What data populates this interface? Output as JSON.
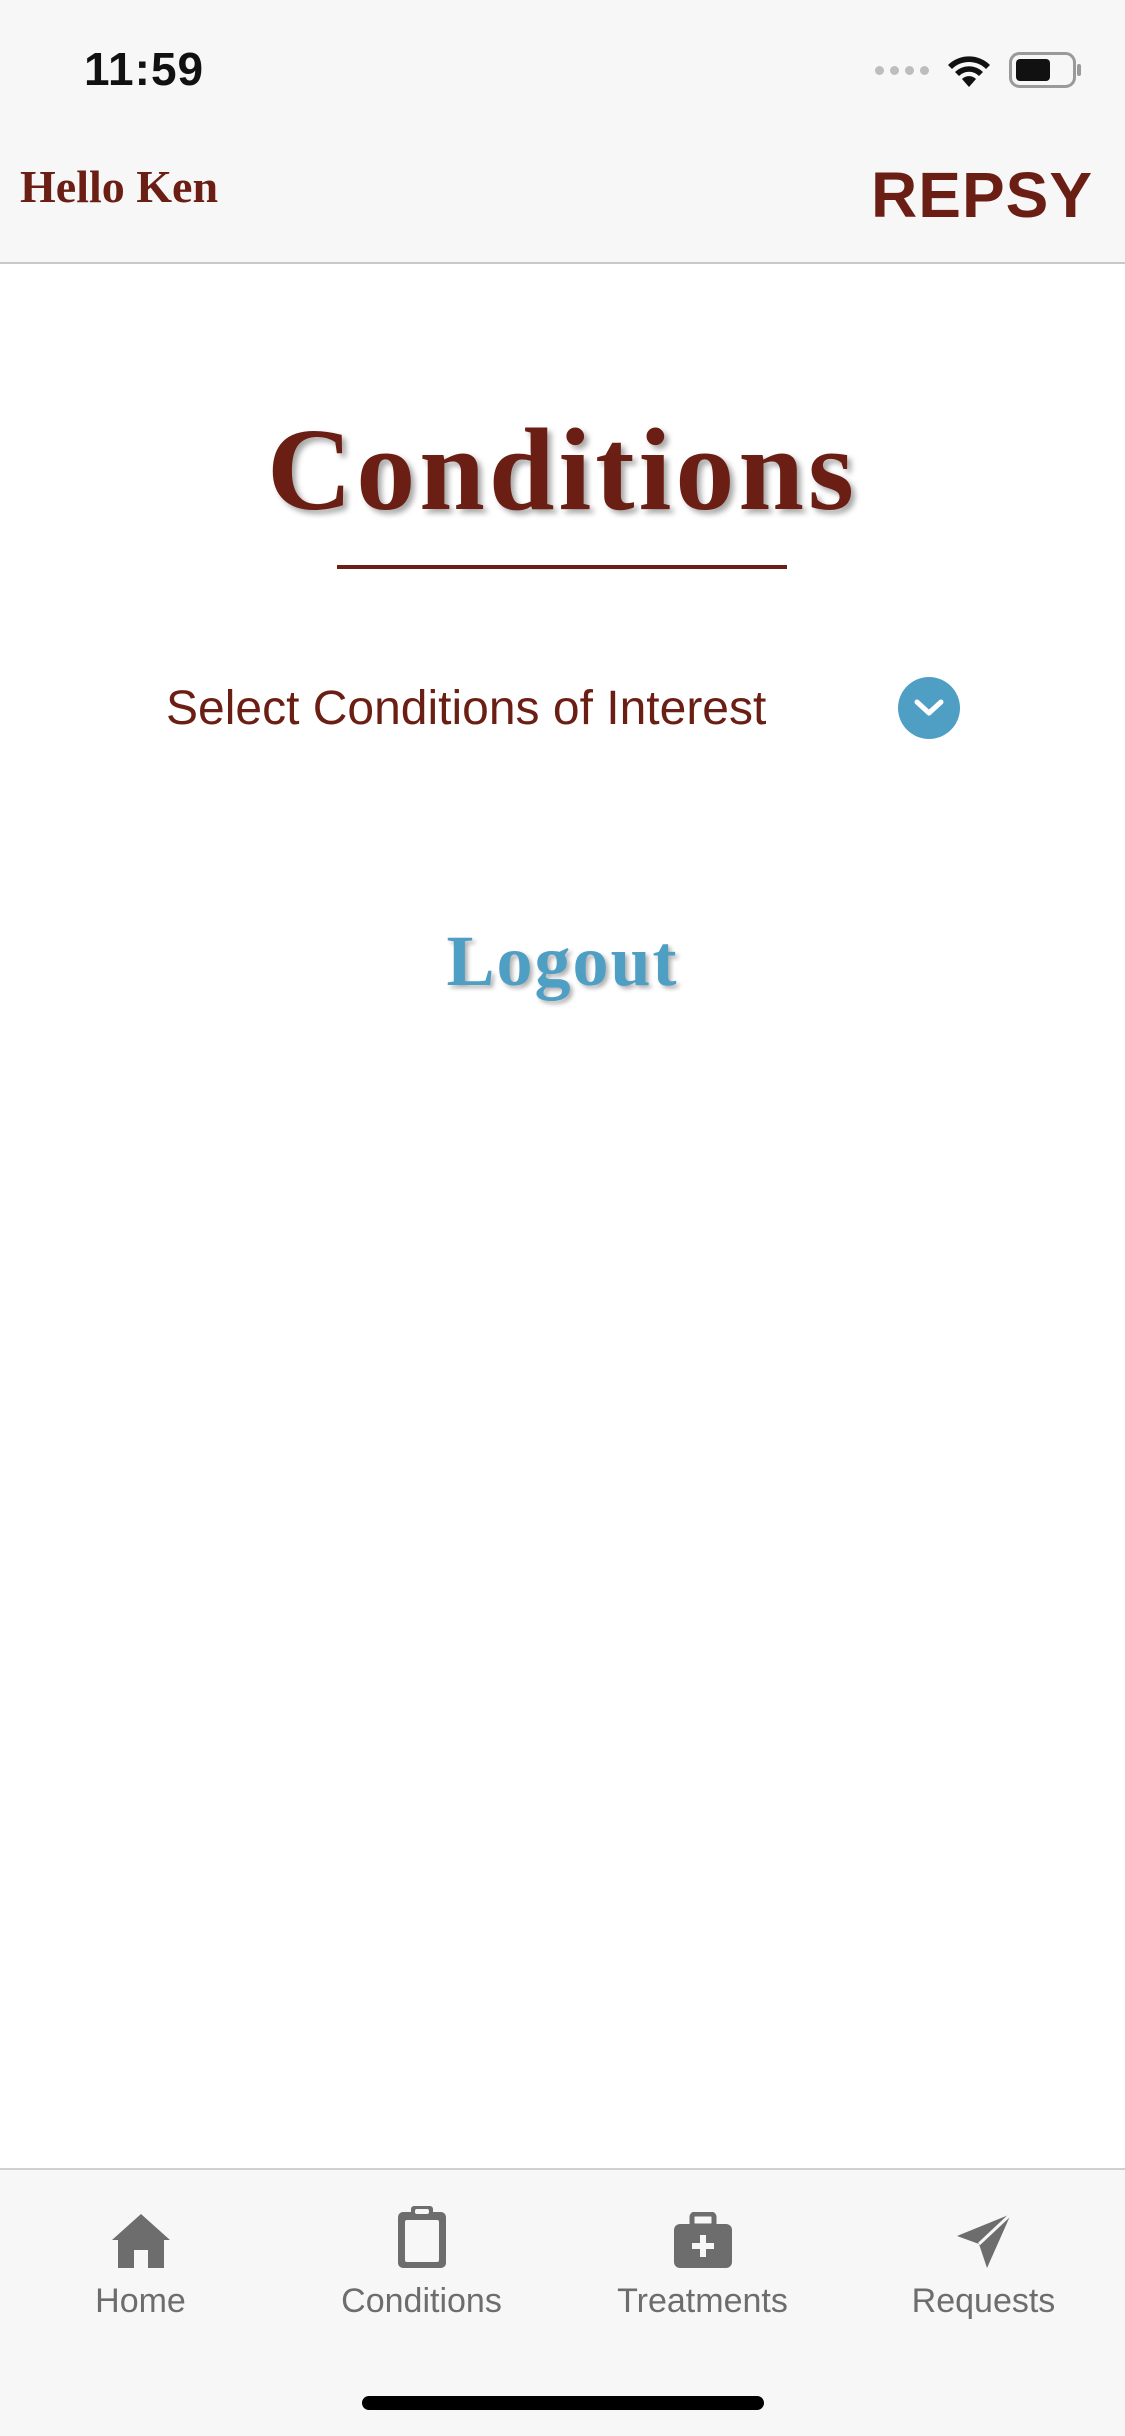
{
  "status_bar": {
    "time": "11:59"
  },
  "header": {
    "greeting": "Hello Ken",
    "brand": "REPSY"
  },
  "main": {
    "title": "Conditions",
    "selector_label": "Select Conditions of Interest",
    "logout_label": "Logout"
  },
  "tabs": [
    {
      "label": "Home",
      "icon": "home-icon"
    },
    {
      "label": "Conditions",
      "icon": "clipboard-icon"
    },
    {
      "label": "Treatments",
      "icon": "medkit-icon"
    },
    {
      "label": "Requests",
      "icon": "send-icon"
    }
  ],
  "colors": {
    "brand": "#6b1f14",
    "accent": "#4f9fc4",
    "tab_icon": "#6d6d6d"
  }
}
